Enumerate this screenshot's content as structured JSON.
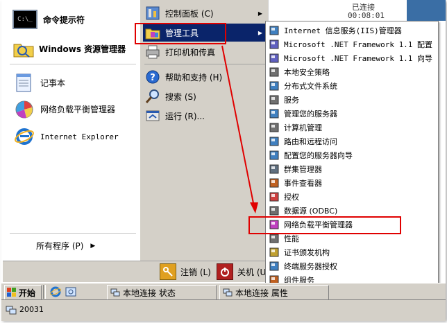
{
  "start_menu": {
    "pinned": [
      {
        "label": "命令提示符",
        "icon": "cmd-icon"
      },
      {
        "label": "Windows 资源管理器",
        "icon": "explorer-icon"
      }
    ],
    "recent": [
      {
        "label": "记事本",
        "icon": "notepad-icon"
      },
      {
        "label": "网络负载平衡管理器",
        "icon": "nlb-icon"
      },
      {
        "label": "Internet Explorer",
        "icon": "ie-icon"
      }
    ],
    "all_programs": "所有程序 (P)",
    "right": [
      {
        "label": "控制面板 (C)",
        "icon": "control-panel-icon",
        "arrow": true
      },
      {
        "label": "管理工具",
        "icon": "admin-tools-icon",
        "arrow": true,
        "highlight": true
      },
      {
        "label": "打印机和传真",
        "icon": "printer-icon",
        "arrow": false
      },
      {
        "label": "帮助和支持 (H)",
        "icon": "help-icon",
        "arrow": false
      },
      {
        "label": "搜索 (S)",
        "icon": "search-icon",
        "arrow": false
      },
      {
        "label": "运行 (R)...",
        "icon": "run-icon",
        "arrow": false
      }
    ],
    "logoff": "注销 (L)",
    "shutdown": "关机 (U)"
  },
  "admin_tools_submenu": [
    "Internet 信息服务(IIS)管理器",
    "Microsoft .NET Framework 1.1 配置",
    "Microsoft .NET Framework 1.1 向导",
    "本地安全策略",
    "分布式文件系统",
    "服务",
    "管理您的服务器",
    "计算机管理",
    "路由和远程访问",
    "配置您的服务器向导",
    "群集管理器",
    "事件查看器",
    "授权",
    "数据源 (ODBC)",
    "网络负载平衡管理器",
    "性能",
    "证书颁发机构",
    "终端服务器授权",
    "组件服务"
  ],
  "background_window": {
    "text1": "已连接",
    "text2": "00:08:01"
  },
  "taskbar": {
    "start_label": "开始",
    "tasks": [
      "本地连接 状态",
      "本地连接 属性"
    ]
  },
  "statusbar": {
    "text": "20031"
  },
  "colors": {
    "highlight": "#0a246a",
    "annotation": "#e00000",
    "menu_face": "#d4d0c8"
  }
}
